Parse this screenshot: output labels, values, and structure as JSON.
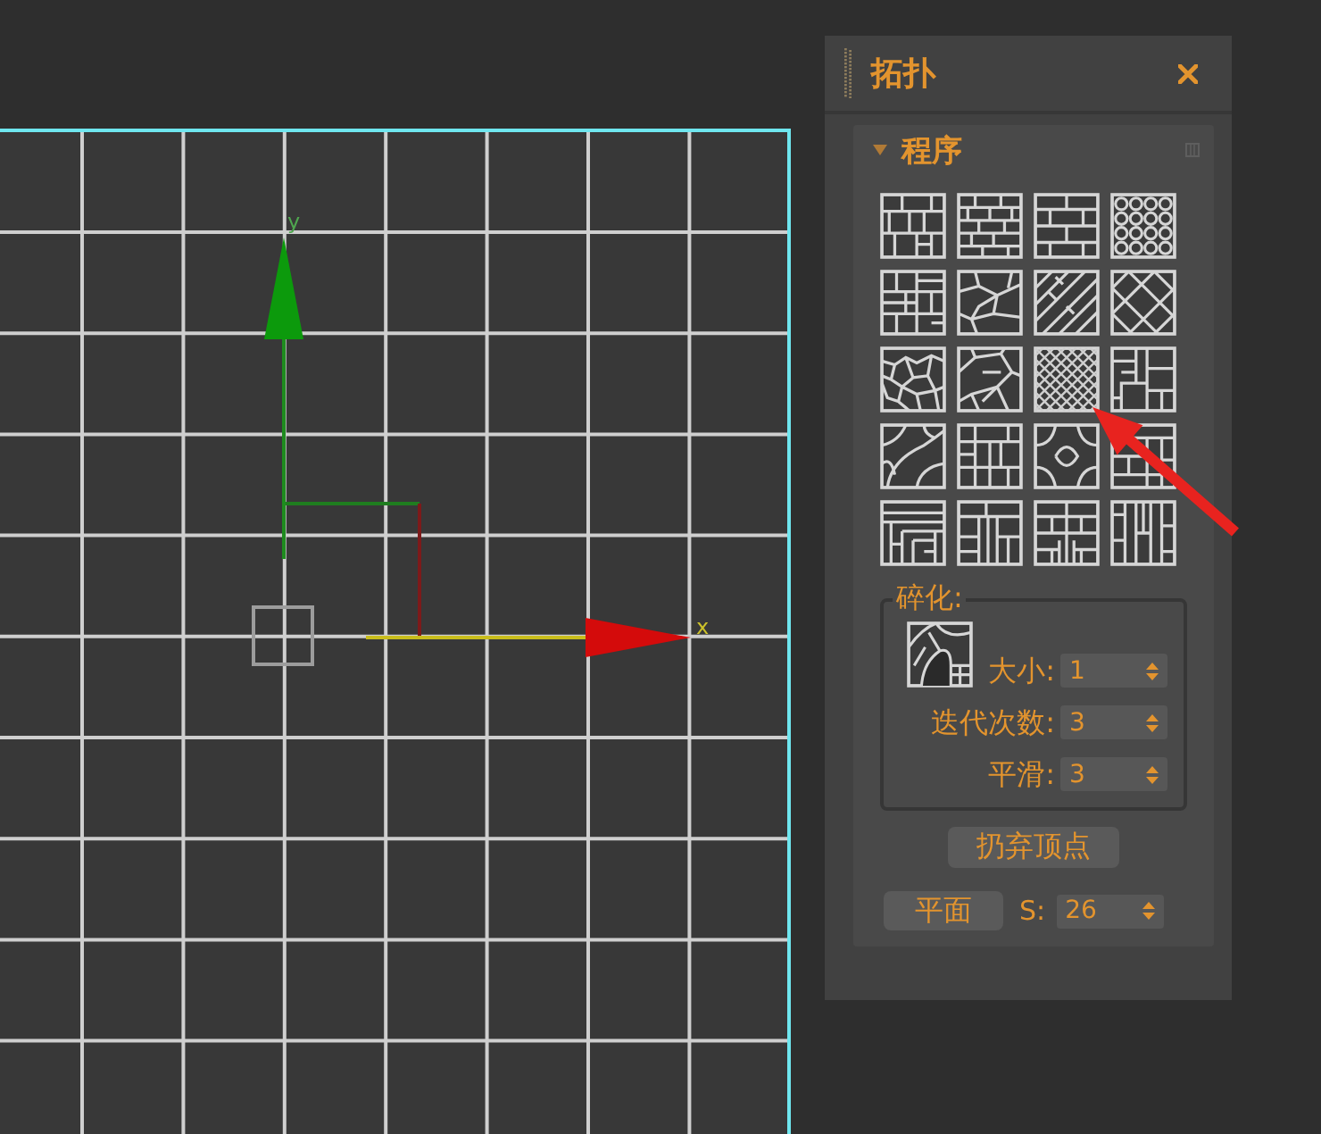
{
  "viewport": {
    "y_axis_label": "y",
    "x_axis_label": "x"
  },
  "panel": {
    "title": "拓扑"
  },
  "rollout": {
    "title": "程序",
    "expanded": true
  },
  "fragment_group": {
    "label": "碎化:",
    "fields": [
      {
        "label": "大小:",
        "value": "1"
      },
      {
        "label": "迭代次数:",
        "value": "3"
      },
      {
        "label": "平滑:",
        "value": "3"
      }
    ]
  },
  "discard_vertices_button": "扔弃顶点",
  "plane_button": "平面",
  "s_field": {
    "label": "S:",
    "value": "26"
  }
}
